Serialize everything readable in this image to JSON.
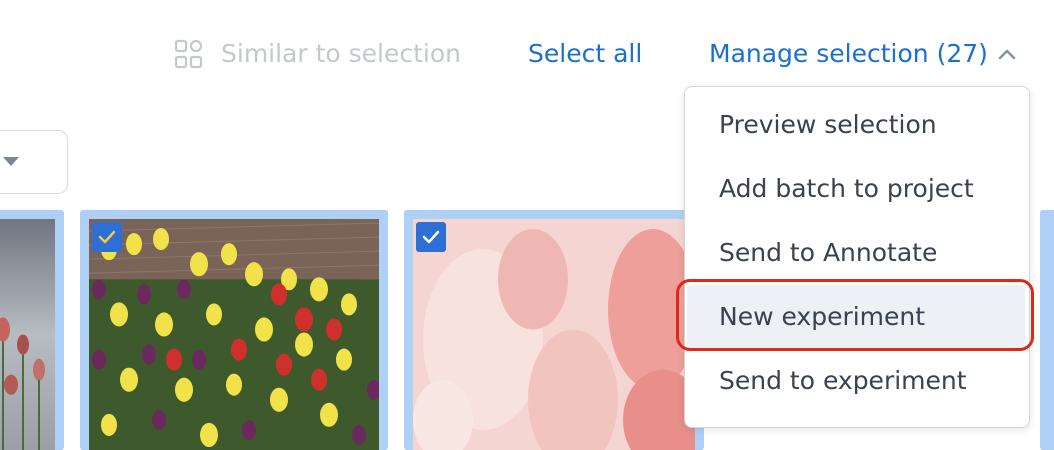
{
  "toolbar": {
    "similar_label": "Similar to selection",
    "select_all_label": "Select all",
    "manage_label": "Manage selection (27)"
  },
  "menu": {
    "items": [
      "Preview selection",
      "Add batch to project",
      "Send to Annotate",
      "New experiment",
      "Send to experiment"
    ],
    "highlighted_item": "New experiment"
  },
  "colors": {
    "accent": "#1b6fd0",
    "disabled": "#c3c8cf",
    "highlight": "#e0281a",
    "card_selected_border": "#aed0f6",
    "checkbox": "#2e6fd6"
  },
  "icons": {
    "similar": "grid-shapes-icon",
    "manage": "chevron-up-icon",
    "dropdown": "caret-down-icon",
    "checkbox": "checkmark-icon"
  }
}
